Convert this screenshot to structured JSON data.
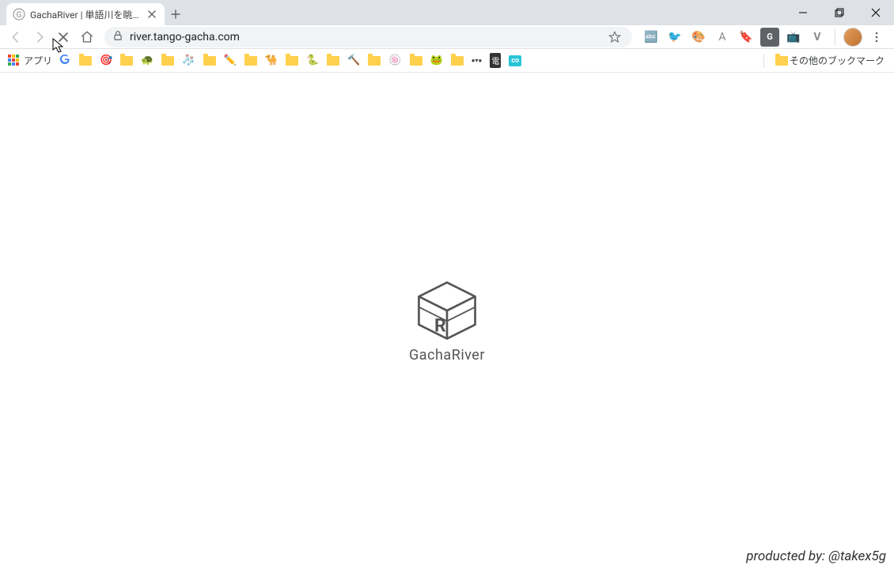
{
  "tab": {
    "title": "GachaRiver | 単語川を眺めて心を洗",
    "favicon_letter": "G"
  },
  "toolbar": {
    "url": "river.tango-gacha.com"
  },
  "bookmarks": {
    "apps_label": "アプリ",
    "other_label": "その他のブックマーク",
    "items": [
      {
        "glyph": "G",
        "name": "google"
      },
      {
        "glyph": "",
        "name": "folder-1"
      },
      {
        "glyph": "🎯",
        "name": "target"
      },
      {
        "glyph": "",
        "name": "folder-2"
      },
      {
        "glyph": "🐢",
        "name": "turtle"
      },
      {
        "glyph": "",
        "name": "folder-3"
      },
      {
        "glyph": "🧦",
        "name": "sock"
      },
      {
        "glyph": "",
        "name": "folder-4"
      },
      {
        "glyph": "✏️",
        "name": "pencil"
      },
      {
        "glyph": "",
        "name": "folder-5"
      },
      {
        "glyph": "🐪",
        "name": "camel"
      },
      {
        "glyph": "",
        "name": "folder-6"
      },
      {
        "glyph": "🐍",
        "name": "snake"
      },
      {
        "glyph": "",
        "name": "folder-7"
      },
      {
        "glyph": "🔨",
        "name": "hammer"
      },
      {
        "glyph": "",
        "name": "folder-8"
      },
      {
        "glyph": "🍥",
        "name": "naruto"
      },
      {
        "glyph": "",
        "name": "folder-9"
      },
      {
        "glyph": "🐸",
        "name": "frog"
      },
      {
        "glyph": "",
        "name": "folder-10"
      },
      {
        "glyph": "●▾●",
        "name": "dots"
      },
      {
        "glyph": "電",
        "name": "den"
      },
      {
        "glyph": "co",
        "name": "co",
        "bg": "#29c4d6"
      }
    ]
  },
  "page": {
    "logo_text": "GachaRiver",
    "credit_prefix": "producted by: ",
    "credit_handle": "@takex5g"
  }
}
